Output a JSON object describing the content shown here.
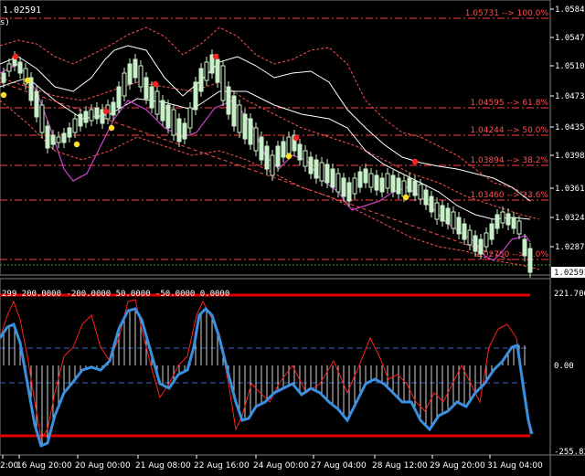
{
  "symbol_price": "1.02591",
  "price_axis": {
    "ticks": [
      "1.05840",
      "1.05470",
      "1.05100",
      "1.04730",
      "1.04350",
      "1.03980",
      "1.03610",
      "1.03240",
      "1.02870"
    ],
    "current_price": "1.02591",
    "current_price_sub": "1.02591"
  },
  "fib_levels": [
    {
      "label": "1.05731 --> 100.0%"
    },
    {
      "label": "1.04595 --> 61.8%"
    },
    {
      "label": "1.04244 --> 50.0%"
    },
    {
      "label": "1.03894 --> 38.2%"
    },
    {
      "label": "1.03460 --> 23.6%"
    },
    {
      "label": "1.02750 --> 0.0%"
    }
  ],
  "indicator": {
    "params": "299 200.0000 -200.0000 50.0000 -50.0000 0.0000",
    "axis_ticks": [
      "221.7063",
      "0.00",
      "-255.8340"
    ]
  },
  "time_axis": [
    "2:00",
    "16 Aug 20:00",
    "20 Aug 00:00",
    "21 Aug 08:00",
    "22 Aug 16:00",
    "24 Aug 00:00",
    "27 Aug 04:00",
    "28 Aug 12:00",
    "29 Aug 20:00",
    "31 Aug 04:00"
  ],
  "colors": {
    "background": "#000000",
    "bull_candle": "#c8f0c8",
    "bear_candle": "#ffffff",
    "fib": "#ff4040",
    "cci": "#3a90e0",
    "cci_fast": "#ff2020",
    "bollinger": "#ff5050",
    "ma_white": "#ffffff",
    "ma_magenta": "#c040c0",
    "dot_red": "#ff2020",
    "dot_yellow": "#ffe020",
    "axis_text": "#ffffff"
  }
}
